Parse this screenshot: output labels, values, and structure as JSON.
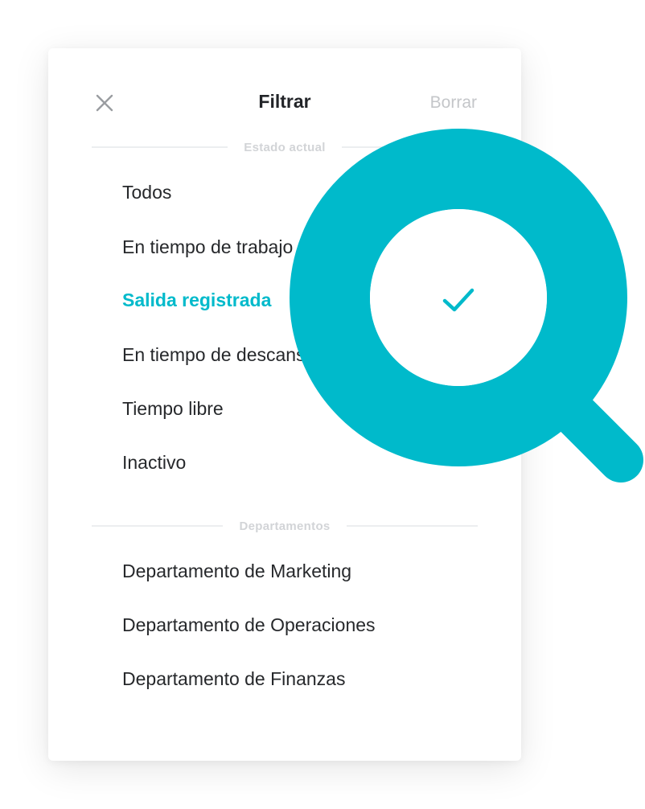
{
  "header": {
    "title": "Filtrar",
    "clear_label": "Borrar"
  },
  "sections": {
    "status": {
      "label": "Estado actual",
      "options": [
        "Todos",
        "En tiempo de trabajo",
        "Salida registrada",
        "En tiempo de descanso",
        "Tiempo libre",
        "Inactivo"
      ],
      "selected": "Salida registrada"
    },
    "departments": {
      "label": "Departamentos",
      "options": [
        "Departamento de Marketing",
        "Departamento de Operaciones",
        "Departamento de Finanzas"
      ]
    }
  },
  "colors": {
    "accent": "#00bacb",
    "text": "#26282b",
    "muted": "#c4c6c9",
    "divider": "#eceef0"
  },
  "icons": {
    "close": "close-icon",
    "check": "check-icon",
    "magnifier": "magnifying-glass-icon"
  }
}
